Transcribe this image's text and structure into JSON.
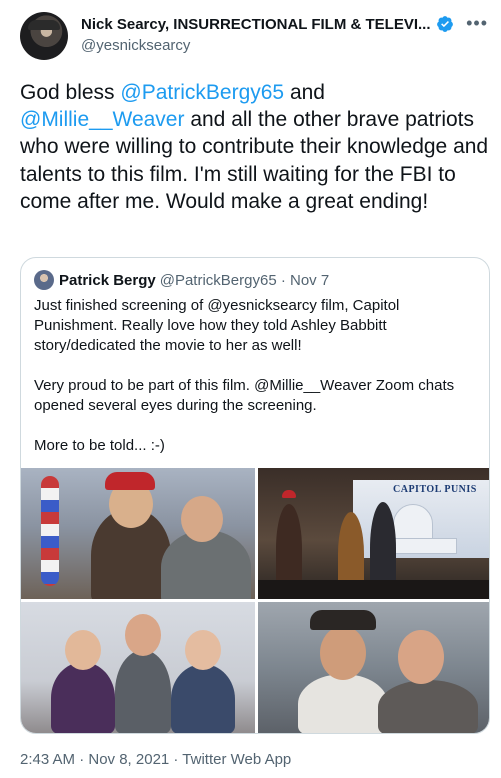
{
  "author": {
    "display_name": "Nick Searcy, INSURRECTIONAL FILM & TELEVI...",
    "handle": "@yesnicksearcy",
    "verified_icon": "verified-badge-icon",
    "more_icon": "more-options-icon"
  },
  "tweet": {
    "text_parts": [
      {
        "text": "God bless ",
        "mention": false
      },
      {
        "text": "@PatrickBergy65",
        "mention": true
      },
      {
        "text": " and ",
        "mention": false
      },
      {
        "text": "@Millie__Weaver",
        "mention": true
      },
      {
        "text": " and all the other brave patriots who were willing to contribute their knowledge and talents to this film. I'm still waiting for the FBI to come after me.  Would make a great ending!",
        "mention": false
      }
    ],
    "timestamp": "2:43 AM · Nov 8, 2021 · Twitter Web App"
  },
  "quoted": {
    "display_name": "Patrick Bergy",
    "handle_date": "@PatrickBergy65 · Nov 7",
    "paragraphs": [
      "Just finished screening of @yesnicksearcy film, Capitol Punishment. Really love how they told Ashley Babbitt story/dedicated the movie to her as well!",
      "Very proud to be part of this film. @Millie__Weaver Zoom chats opened several eyes during the screening.",
      "More to be told... :-)"
    ],
    "photo_banner_text": "CAPITOL PUNIS"
  },
  "colors": {
    "accent": "#1d9bf0",
    "text": "#0f1419",
    "secondary": "#536471",
    "border": "#cfd9de"
  }
}
